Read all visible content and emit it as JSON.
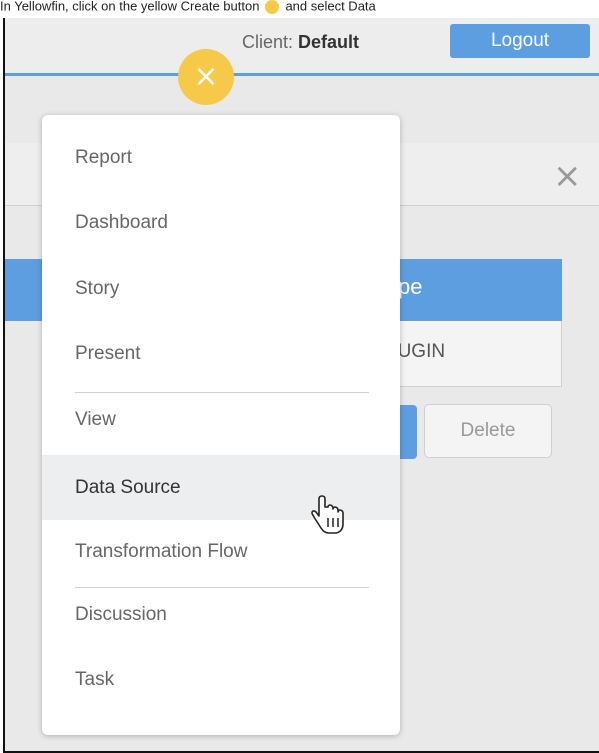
{
  "caption": {
    "text_before": "In Yellowfin, click on the yellow Create button",
    "text_after": "and select Data"
  },
  "header": {
    "client_label": "Client:",
    "client_value": "Default",
    "logout_label": "Logout",
    "create_icon": "×"
  },
  "panel": {
    "close_icon": "×",
    "type_header": "ype",
    "type_value": "LUGIN",
    "delete_label": "Delete"
  },
  "menu": {
    "items": [
      {
        "label": "Report"
      },
      {
        "label": "Dashboard"
      },
      {
        "label": "Story"
      },
      {
        "label": "Present"
      },
      {
        "label": "View"
      },
      {
        "label": "Data Source",
        "highlighted": true
      },
      {
        "label": "Transformation Flow"
      },
      {
        "label": "Discussion"
      },
      {
        "label": "Task"
      }
    ]
  },
  "colors": {
    "accent_blue": "#5d9ee0",
    "create_yellow": "#f7c948",
    "highlight": "#eceef0"
  }
}
